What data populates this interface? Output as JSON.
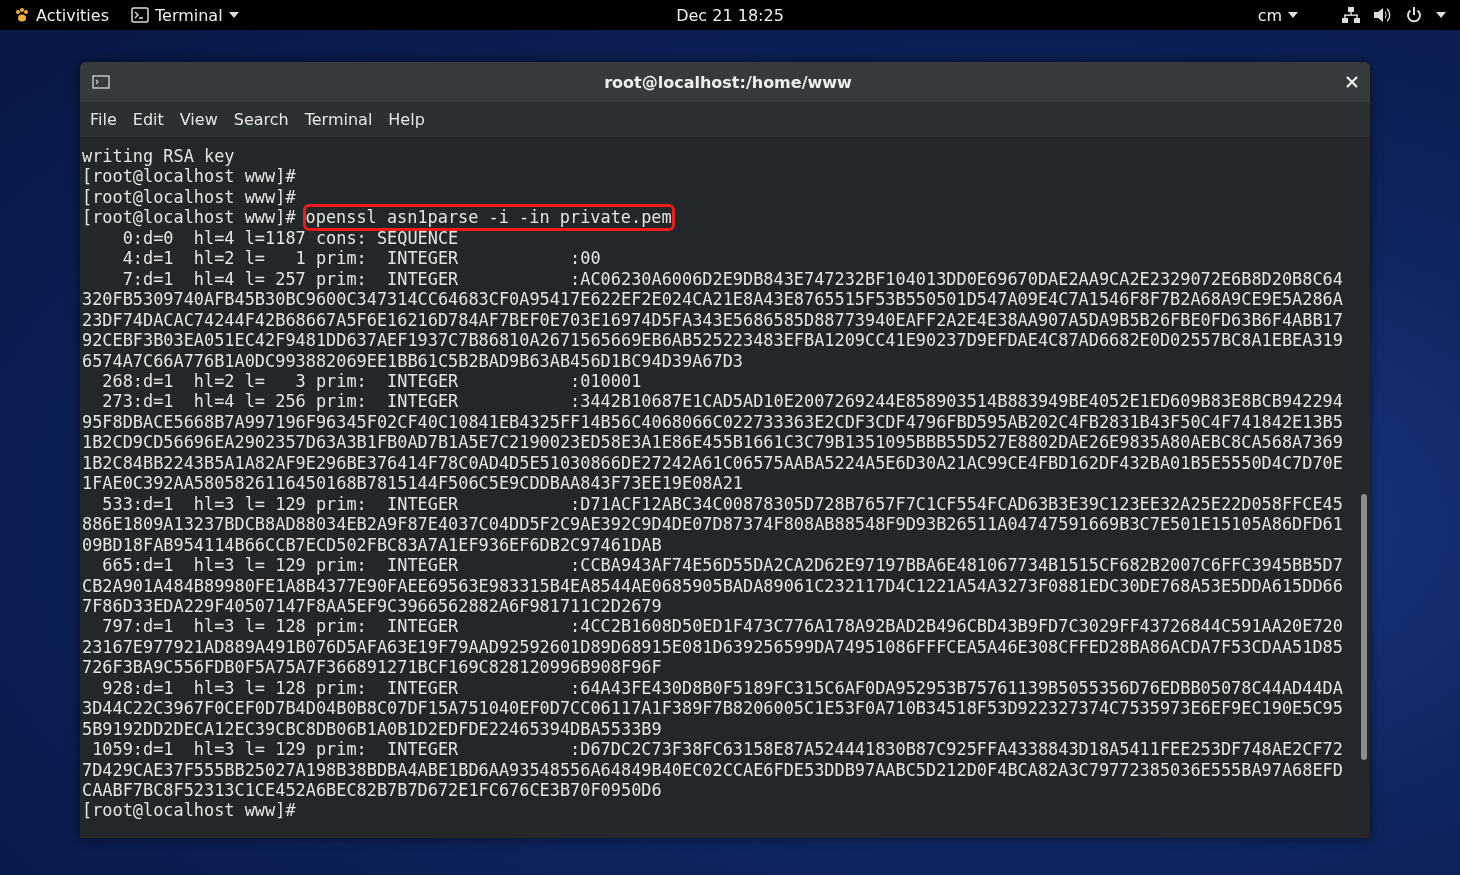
{
  "top_bar": {
    "activities": "Activities",
    "app_menu": "Terminal",
    "clock": "Dec 21  18:25",
    "user_menu": "cm"
  },
  "window": {
    "title": "root@localhost:/home/www"
  },
  "menu": [
    "File",
    "Edit",
    "View",
    "Search",
    "Terminal",
    "Help"
  ],
  "terminal": {
    "lines": [
      {
        "kind": "output",
        "text": "writing RSA key"
      },
      {
        "kind": "output",
        "text": "[root@localhost www]#"
      },
      {
        "kind": "output",
        "text": "[root@localhost www]#"
      },
      {
        "kind": "command",
        "prompt": "[root@localhost www]#",
        "command": "openssl asn1parse -i -in private.pem",
        "highlighted": true
      },
      {
        "kind": "output",
        "text": "    0:d=0  hl=4 l=1187 cons: SEQUENCE"
      },
      {
        "kind": "output",
        "text": "    4:d=1  hl=2 l=   1 prim:  INTEGER           :00"
      },
      {
        "kind": "output",
        "text": "    7:d=1  hl=4 l= 257 prim:  INTEGER           :AC06230A6006D2E9DB843E747232BF104013DD0E69670DAE2AA9CA2E2329072E6B8D20B8C64"
      },
      {
        "kind": "output",
        "text": "320FB5309740AFB45B30BC9600C347314CC64683CF0A95417E622EF2E024CA21E8A43E8765515F53B550501D547A09E4C7A1546F8F7B2A68A9CE9E5A286A"
      },
      {
        "kind": "output",
        "text": "23DF74DACAC74244F42B68667A5F6E16216D784AF7BEF0E703E16974D5FA343E5686585D88773940EAFF2A2E4E38AA907A5DA9B5B26FBE0FD63B6F4ABB17"
      },
      {
        "kind": "output",
        "text": "92CEBF3B03EA051EC42F9481DD637AEF1937C7B86810A2671565669EB6AB525223483EFBA1209CC41E90237D9EFDAE4C87AD6682E0D02557BC8A1EBEA319"
      },
      {
        "kind": "output",
        "text": "6574A7C66A776B1A0DC993882069EE1BB61C5B2BAD9B63AB456D1BC94D39A67D3"
      },
      {
        "kind": "output",
        "text": "  268:d=1  hl=2 l=   3 prim:  INTEGER           :010001"
      },
      {
        "kind": "output",
        "text": "  273:d=1  hl=4 l= 256 prim:  INTEGER           :3442B10687E1CAD5AD10E2007269244E858903514B883949BE4052E1ED609B83E8BCB942294"
      },
      {
        "kind": "output",
        "text": "95F8DBACE5668B7A997196F96345F02CF40C10841EB4325FF14B56C4068066C022733363E2CDF3CDF4796FBD595AB202C4FB2831B43F50C4F741842E13B5"
      },
      {
        "kind": "output",
        "text": "1B2CD9CD56696EA2902357D63A3B1FB0AD7B1A5E7C2190023ED58E3A1E86E455B1661C3C79B1351095BBB55D527E8802DAE26E9835A80AEBC8CA568A7369"
      },
      {
        "kind": "output",
        "text": "1B2C84BB2243B5A1A82AF9E296BE376414F78C0AD4D5E51030866DE27242A61C06575AABA5224A5E6D30A21AC99CE4FBD162DF432BA01B5E5550D4C7D70E"
      },
      {
        "kind": "output",
        "text": "1FAE0C392AA5805826116450168B7815144F506C5E9CDDBAA843F73EE19E08A21"
      },
      {
        "kind": "output",
        "text": "  533:d=1  hl=3 l= 129 prim:  INTEGER           :D71ACF12ABC34C00878305D728B7657F7C1CF554FCAD63B3E39C123EE32A25E22D058FFCE45"
      },
      {
        "kind": "output",
        "text": "886E1809A13237BDCB8AD88034EB2A9F87E4037C04DD5F2C9AE392C9D4DE07D87374F808AB88548F9D93B26511A04747591669B3C7E501E15105A86DFD61"
      },
      {
        "kind": "output",
        "text": "09BD18FAB954114B66CCB7ECD502FBC83A7A1EF936EF6DB2C97461DAB"
      },
      {
        "kind": "output",
        "text": "  665:d=1  hl=3 l= 129 prim:  INTEGER           :CCBA943AF74E56D55DA2CA2D62E97197BBA6E481067734B1515CF682B2007C6FFC3945BB5D7"
      },
      {
        "kind": "output",
        "text": "CB2A901A484B89980FE1A8B4377E90FAEE69563E983315B4EA8544AE0685905BADA89061C232117D4C1221A54A3273F0881EDC30DE768A53E5DDA615DD66"
      },
      {
        "kind": "output",
        "text": "7F86D33EDA229F40507147F8AA5EF9C3966562882A6F981711C2D2679"
      },
      {
        "kind": "output",
        "text": "  797:d=1  hl=3 l= 128 prim:  INTEGER           :4CC2B1608D50ED1F473C776A178A92BAD2B496CBD43B9FD7C3029FF43726844C591AA20E720"
      },
      {
        "kind": "output",
        "text": "23167E977921AD889A491B076D5AFA63E19F79AAD92592601D89D68915E081D639256599DA74951086FFFCEA5A46E308CFFED28BA86ACDA7F53CDAA51D85"
      },
      {
        "kind": "output",
        "text": "726F3BA9C556FDB0F5A75A7F366891271BCF169C828120996B908F96F"
      },
      {
        "kind": "output",
        "text": "  928:d=1  hl=3 l= 128 prim:  INTEGER           :64A43FE430D8B0F5189FC315C6AF0DA952953B75761139B5055356D76EDBB05078C44AD44DA"
      },
      {
        "kind": "output",
        "text": "3D44C22C3967F0CEF0D7B4D04B0B8C07DF15A751040EF0D7CC06117A1F389F7B8206005C1E53F0A710B34518F53D922327374C7535973E6EF9EC190E5C95"
      },
      {
        "kind": "output",
        "text": "5B9192DD2DECA12EC39CBC8DB06B1A0B1D2EDFDE22465394DBA5533B9"
      },
      {
        "kind": "output",
        "text": " 1059:d=1  hl=3 l= 129 prim:  INTEGER           :D67DC2C73F38FC63158E87A524441830B87C925FFA4338843D18A5411FEE253DF748AE2CF72"
      },
      {
        "kind": "output",
        "text": "7D429CAE37F555BB25027A198B38BDBA4ABE1BD6AA93548556A64849B40EC02CCAE6FDE53DDB97AABC5D212D0F4BCA82A3C79772385036E555BA97A68EFD"
      },
      {
        "kind": "output",
        "text": "CAABF7BC8F52313C1CE452A6BEC82B7B7D672E1FC676CE3B70F0950D6"
      },
      {
        "kind": "output",
        "text": "[root@localhost www]#"
      }
    ]
  }
}
